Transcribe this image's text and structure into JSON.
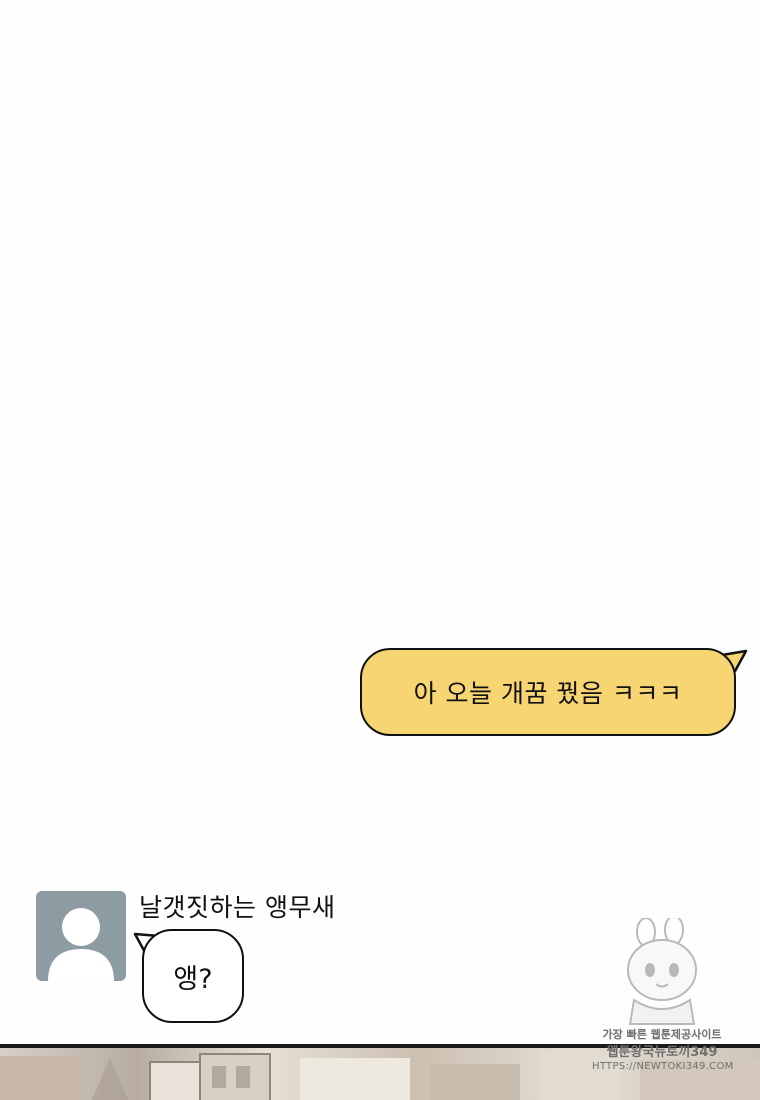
{
  "colors": {
    "outgoing_bubble": "#f8d573",
    "avatar_bg": "#8d9ca2",
    "outline": "#111111"
  },
  "outgoing_message": {
    "text": "아 오늘 개꿈 꿨음 ㅋㅋㅋ"
  },
  "incoming_message": {
    "sender_name": "날갯짓하는 앵무새",
    "text": "앵?",
    "avatar_icon": "default-user-icon"
  },
  "watermark": {
    "line1": "가장 빠른 웹툰제공사이트",
    "line2": "웹툰왕국뉴토끼349",
    "line3": "HTTPS://NEWTOKI349.COM",
    "icon": "rabbit-mascot-icon"
  }
}
